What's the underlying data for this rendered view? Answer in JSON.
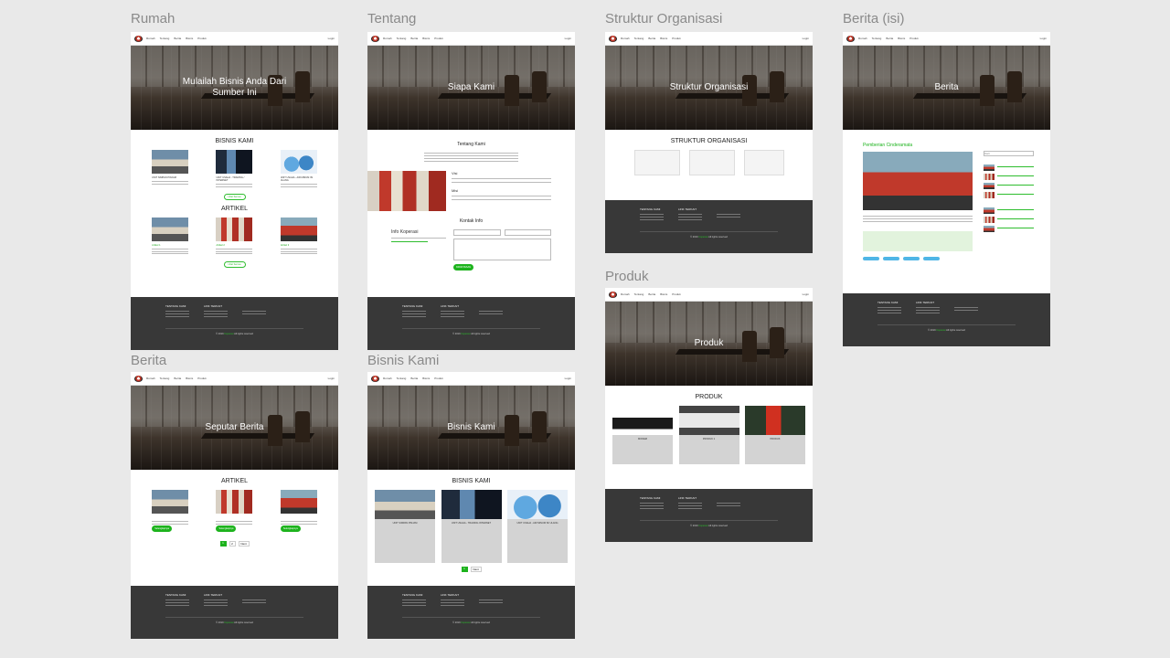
{
  "boards": {
    "rumah": {
      "label": "Rumah",
      "hero": "Mulailah Bisnis Anda Dari Sumber Ini",
      "section1": "BISNIS KAMI",
      "section2": "ARTIKEL",
      "cards1": [
        "UNIT SIMPAN PINJAM",
        "UNIT USAHA - TRADING / INTERNET",
        "UNIT USAHA - AIR MINUM ISI ULANG"
      ],
      "cards2": [
        "Artikel 1",
        "Artikel 2",
        "Artikel 3"
      ],
      "more": "Lihat Semua"
    },
    "tentang": {
      "label": "Tentang",
      "hero": "Siapa Kami",
      "about": "Tentang Kami",
      "visi": "Visi",
      "misi": "Misi",
      "kontak": "Kontak Info",
      "info": "Info Koperasi",
      "send": "KIRIM PESAN"
    },
    "struktur": {
      "label": "Struktur Organisasi",
      "hero": "Struktur Organisasi",
      "section": "STRUKTUR ORGANISASI"
    },
    "berita_isi": {
      "label": "Berita (isi)",
      "hero": "Berita",
      "article_title": "Pemberian Cinderamata",
      "search_placeholder": "Cari"
    },
    "produk": {
      "label": "Produk",
      "hero": "Produk",
      "section": "PRODUK",
      "items": [
        "MODEM",
        "PRODUK 1",
        "PRODUK"
      ]
    },
    "berita": {
      "label": "Berita",
      "hero": "Seputar Berita",
      "section": "ARTIKEL",
      "read_more": "Selengkapnya",
      "pages": [
        "1",
        "2",
        "Next"
      ]
    },
    "bisnis": {
      "label": "Bisnis Kami",
      "hero": "Bisnis Kami",
      "section": "BISNIS KAMI",
      "items": [
        "UNIT SIMPAN PINJAM",
        "UNIT USAHA - TRADING INTERNET",
        "UNIT USAHA - AIR MINUM ISI ULANG"
      ],
      "pages": [
        "1",
        "Next"
      ]
    }
  },
  "nav": {
    "links": [
      "Rumah",
      "Tentang",
      "Berita",
      "Bisnis",
      "Produk"
    ],
    "login": "Login"
  },
  "footer": {
    "col1": "TENTANG KAMI",
    "col2": "LINK TERKAIT",
    "copy_prefix": "© 2019 ",
    "copy_brand": "Koperasi",
    "copy_suffix": " All rights reserved"
  },
  "colors": {
    "accent": "#1db31d",
    "footer": "#383838",
    "canvas": "#e9e9e9"
  }
}
